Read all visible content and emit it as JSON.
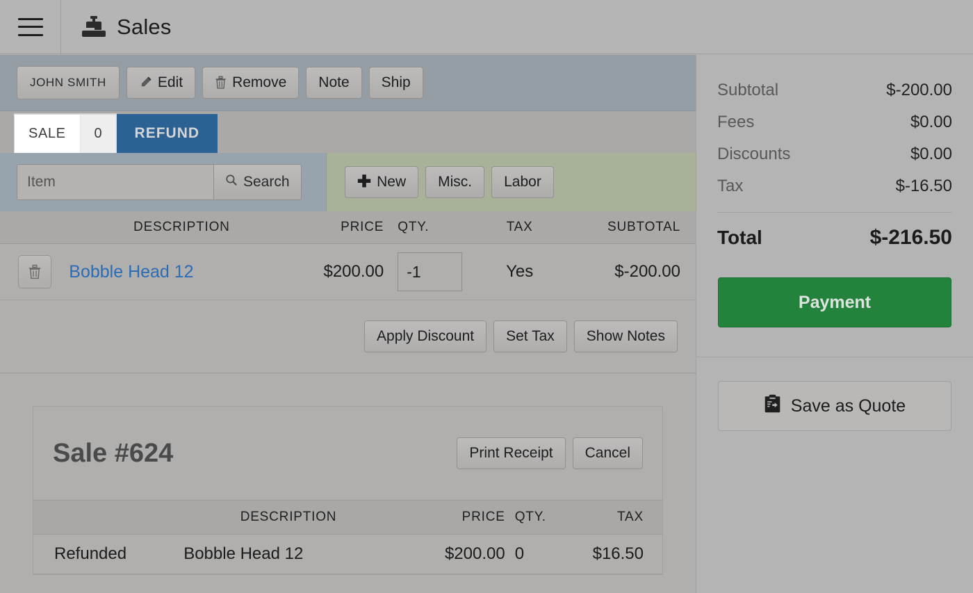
{
  "header": {
    "menu_icon": "hamburger-icon",
    "app_icon": "cash-register-icon",
    "title": "Sales"
  },
  "customer_bar": {
    "customer_name": "JOHN SMITH",
    "edit_label": "Edit",
    "edit_icon": "pencil-icon",
    "remove_label": "Remove",
    "remove_icon": "trash-icon",
    "note_label": "Note",
    "ship_label": "Ship"
  },
  "tabs": {
    "sale_label": "SALE",
    "sale_count": "0",
    "refund_label": "REFUND",
    "refund_color": "#2b6193"
  },
  "search": {
    "placeholder": "Item",
    "value": "",
    "search_label": "Search",
    "search_icon": "magnifier-icon",
    "new_label": "New",
    "new_icon": "plus-icon",
    "misc_label": "Misc.",
    "labor_label": "Labor"
  },
  "line_items": {
    "columns": [
      "",
      "DESCRIPTION",
      "PRICE",
      "QTY.",
      "TAX",
      "SUBTOTAL"
    ],
    "rows": [
      {
        "delete_icon": "trash-icon",
        "description": "Bobble Head 12",
        "price": "$200.00",
        "qty": "-1",
        "tax": "Yes",
        "subtotal": "$-200.00"
      }
    ]
  },
  "item_actions": {
    "apply_discount_label": "Apply Discount",
    "set_tax_label": "Set Tax",
    "show_notes_label": "Show Notes"
  },
  "sale_card": {
    "title_prefix": "Sale",
    "title_number": "#624",
    "print_receipt_label": "Print Receipt",
    "cancel_label": "Cancel",
    "columns": [
      "",
      "DESCRIPTION",
      "PRICE",
      "QTY.",
      "TAX"
    ],
    "rows": [
      {
        "status": "Refunded",
        "description": "Bobble Head 12",
        "price": "$200.00",
        "qty": "0",
        "tax": "$16.50"
      }
    ]
  },
  "totals": {
    "subtotal_label": "Subtotal",
    "subtotal_value": "$-200.00",
    "fees_label": "Fees",
    "fees_value": "$0.00",
    "discounts_label": "Discounts",
    "discounts_value": "$0.00",
    "tax_label": "Tax",
    "tax_value": "$-16.50",
    "total_label": "Total",
    "total_value": "$-216.50"
  },
  "sidebar_actions": {
    "payment_label": "Payment",
    "payment_color": "#23823c",
    "save_quote_label": "Save as Quote",
    "save_quote_icon": "clipboard-quote-icon"
  }
}
